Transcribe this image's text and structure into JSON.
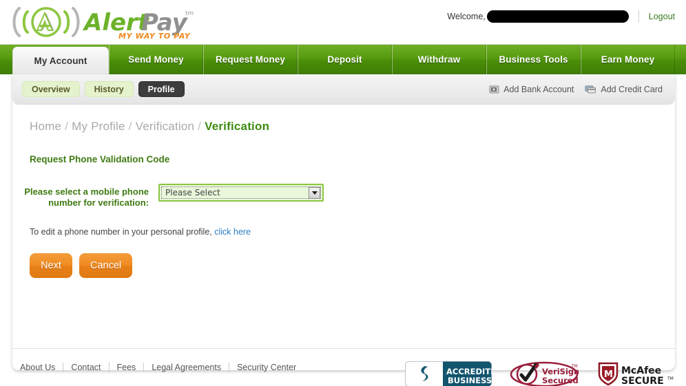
{
  "header": {
    "logo_text": "AlertPay",
    "logo_tagline": "MY WAY TO PAY",
    "logo_tm": "tm",
    "welcome_label": "Welcome,",
    "welcome_user": "",
    "logout_label": "Logout"
  },
  "mainnav": {
    "items": [
      {
        "label": "My Account",
        "active": true
      },
      {
        "label": "Send Money",
        "active": false
      },
      {
        "label": "Request Money",
        "active": false
      },
      {
        "label": "Deposit",
        "active": false
      },
      {
        "label": "Withdraw",
        "active": false
      },
      {
        "label": "Business Tools",
        "active": false
      },
      {
        "label": "Earn Money",
        "active": false
      }
    ]
  },
  "subnav": {
    "pills": [
      {
        "label": "Overview",
        "active": false
      },
      {
        "label": "History",
        "active": false
      },
      {
        "label": "Profile",
        "active": true
      }
    ],
    "actions": [
      {
        "label": "Add Bank Account",
        "icon": "bank-icon"
      },
      {
        "label": "Add Credit Card",
        "icon": "credit-card-icon"
      }
    ]
  },
  "breadcrumb": {
    "items": [
      "Home",
      "My Profile",
      "Verification"
    ],
    "current": "Verification",
    "separator": "/"
  },
  "main": {
    "section_title": "Request Phone Validation Code",
    "field_label": "Please select a mobile phone number for verification:",
    "select_value": "Please Select",
    "select_options": [
      "Please Select"
    ],
    "hint_text": "To edit a phone number in your personal profile,",
    "hint_link": "click here",
    "buttons": [
      {
        "label": "Next",
        "name": "next-button"
      },
      {
        "label": "Cancel",
        "name": "cancel-button"
      }
    ]
  },
  "footer": {
    "links": [
      "About Us",
      "Contact",
      "Fees",
      "Legal Agreements",
      "Security Center"
    ],
    "badges": [
      {
        "name": "bbb-accredited-business-badge",
        "line1": "ACCREDITED",
        "line2": "BUSINESS"
      },
      {
        "name": "verisign-secured-badge",
        "line1": "VeriSign",
        "line2": "Secured",
        "tm": "TM"
      },
      {
        "name": "mcafee-secure-badge",
        "line1": "McAfee",
        "line2": "SECURE",
        "tm": "TM"
      }
    ]
  },
  "colors": {
    "brand_green": "#4b8f09",
    "accent_green": "#8cc63f",
    "label_green": "#3f7a12",
    "button_orange": "#ef8b20",
    "link_blue": "#2a7ec4",
    "breadcrumb_gray": "#a9a9a9"
  }
}
